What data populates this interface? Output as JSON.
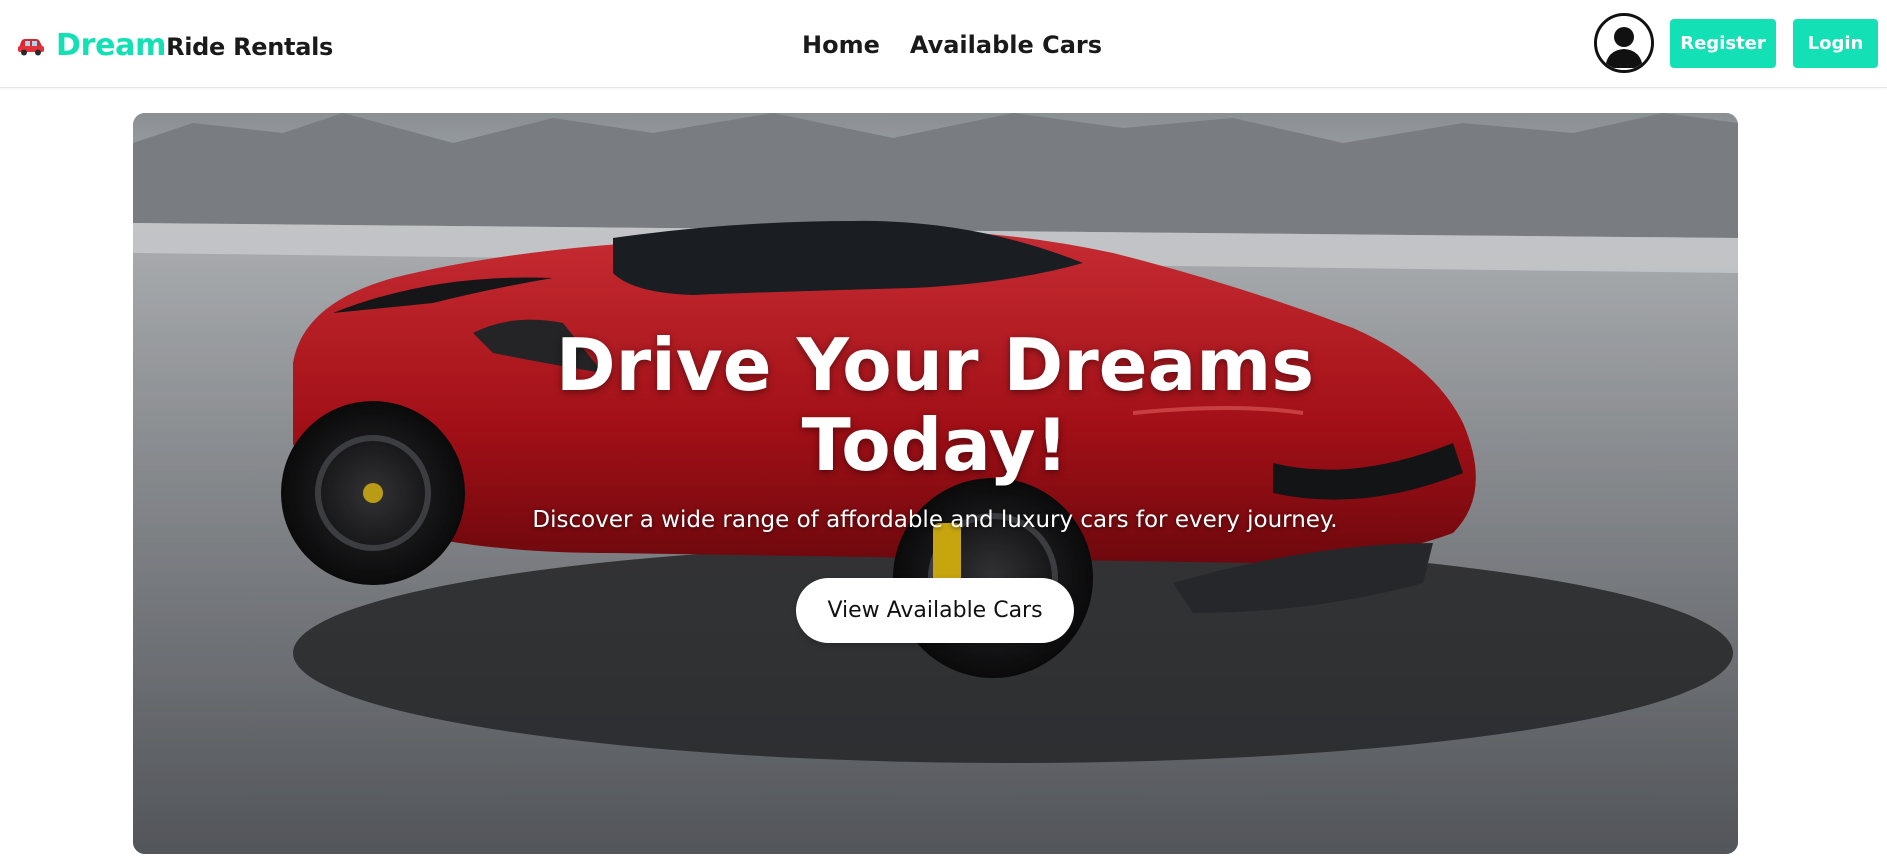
{
  "brand": {
    "icon": "red-car-icon",
    "accent_text": "Dream",
    "rest_text": "Ride Rentals"
  },
  "nav": {
    "links": [
      {
        "label": "Home"
      },
      {
        "label": "Available Cars"
      }
    ]
  },
  "header": {
    "avatar_icon": "user-avatar-icon",
    "register_label": "Register",
    "login_label": "Login"
  },
  "hero": {
    "title": "Drive Your Dreams Today!",
    "subtitle": "Discover a wide range of affordable and luxury cars for every journey.",
    "cta_label": "View Available Cars",
    "image": "red-sports-car-on-salt-flat"
  },
  "colors": {
    "accent": "#13e0b4",
    "car_red": "#c8141c",
    "text_dark": "#1a1a1a"
  }
}
